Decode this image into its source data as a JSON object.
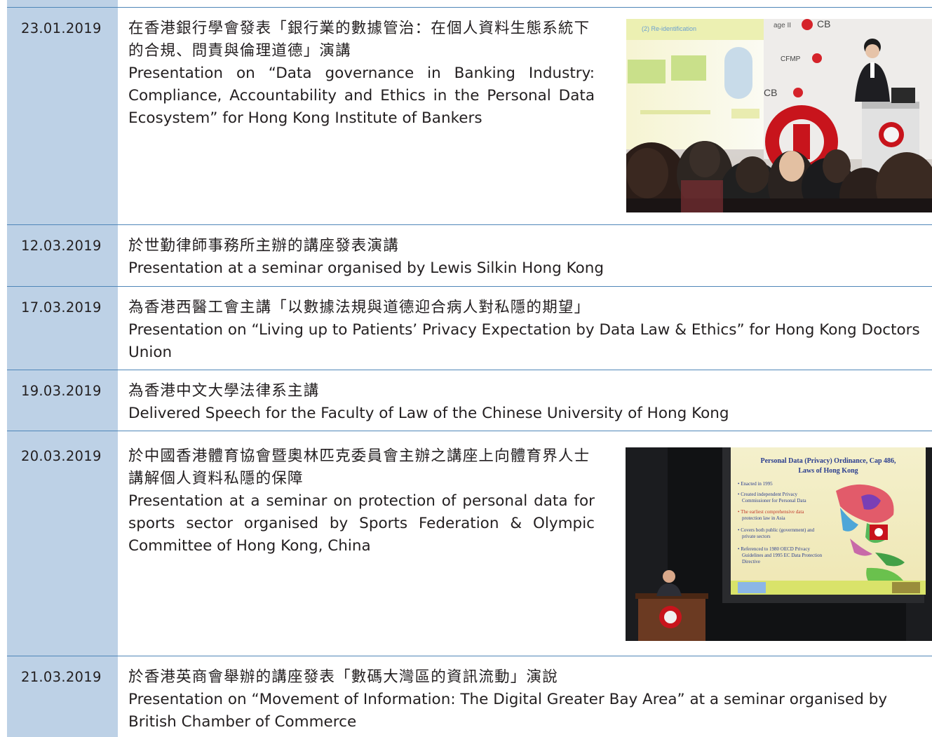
{
  "entries": [
    {
      "date": "23.01.2019",
      "zh": "在香港銀行學會發表「銀行業的數據管治：在個人資料生態系統下的合規、問責與倫理道德」演講",
      "en": "Presentation on “Data governance in Banking Industry: Compliance, Accountability and Ethics in the Personal Data Ecosystem” for Hong Kong Institute of Bankers",
      "photo": {
        "icon": "presentation-photo-bankers",
        "slide_heading": "(2) Re-identification",
        "brand_marks": [
          "HKIB",
          "CB",
          "CFMP"
        ]
      }
    },
    {
      "date": "12.03.2019",
      "zh": "於世勤律師事務所主辦的講座發表演講",
      "en": "Presentation at a seminar organised by Lewis Silkin Hong Kong"
    },
    {
      "date": "17.03.2019",
      "zh": "為香港西醫工會主講「以數據法規與道德迎合病人對私隱的期望」",
      "en": "Presentation on “Living up to Patients’ Privacy Expectation by Data Law & Ethics” for Hong Kong Doctors Union"
    },
    {
      "date": "19.03.2019",
      "zh": "為香港中文大學法律系主講",
      "en": "Delivered Speech for the Faculty of Law of the Chinese University of Hong Kong"
    },
    {
      "date": "20.03.2019",
      "zh": "於中國香港體育協會暨奧林匹克委員會主辦之講座上向體育界人士講解個人資料私隱的保障",
      "en": "Presentation at a seminar on protection of personal data for sports sector organised by Sports Federation & Olympic Committee of Hong Kong, China",
      "photo": {
        "icon": "presentation-photo-olympic",
        "slide_title": "Personal Data (Privacy) Ordinance, Cap 486, Laws of Hong Kong",
        "slide_bullets": [
          "Enacted in 1995",
          "Created independent Privacy Commissioner for Personal Data",
          "The earliest comprehensive data protection law in Asia",
          "Covers both public (government) and private sectors",
          "Referenced to 1980 OECD Privacy Guidelines and 1995 EC Data Protection Directive"
        ]
      }
    },
    {
      "date": "21.03.2019",
      "zh": "於香港英商會舉辦的講座發表「數碼大灣區的資訊流動」演說",
      "en": "Presentation on “Movement of Information: The Digital Greater Bay Area” at a seminar organised by British Chamber of Commerce"
    }
  ],
  "colors": {
    "date_column": "#bdd1e6",
    "rule": "#4f86b8",
    "text": "#231f20"
  }
}
